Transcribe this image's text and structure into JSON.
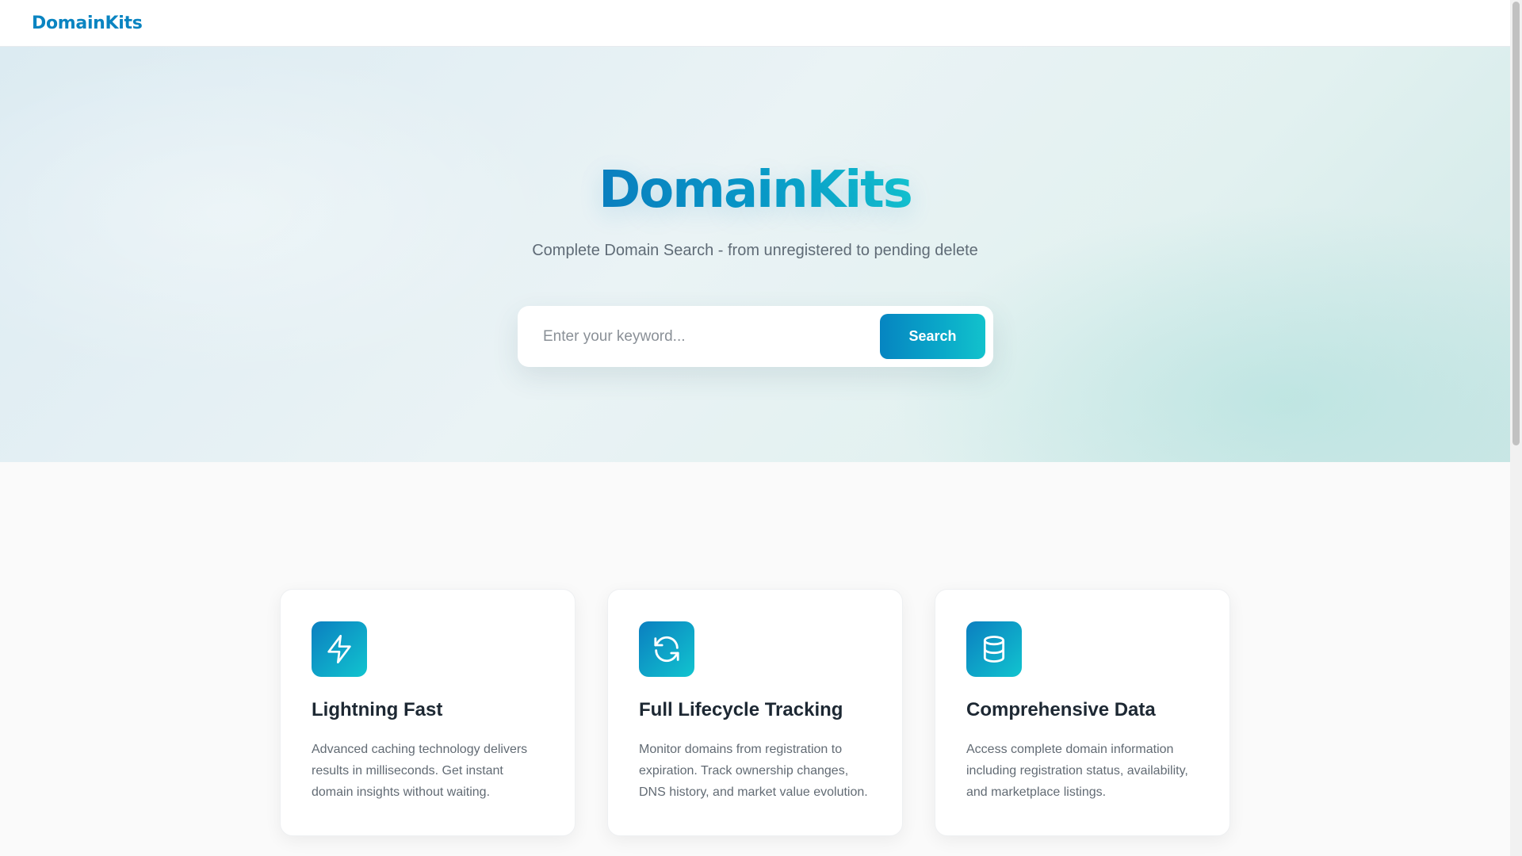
{
  "nav": {
    "brand": "DomainKits"
  },
  "hero": {
    "title": "DomainKits",
    "subtitle": "Complete Domain Search - from unregistered to pending delete",
    "search_placeholder": "Enter your keyword...",
    "search_button": "Search"
  },
  "features": [
    {
      "icon": "lightning-icon",
      "title": "Lightning Fast",
      "description": "Advanced caching technology delivers results in milliseconds. Get instant domain insights without waiting."
    },
    {
      "icon": "refresh-cycle-icon",
      "title": "Full Lifecycle Tracking",
      "description": "Monitor domains from registration to expiration. Track ownership changes, DNS history, and market value evolution."
    },
    {
      "icon": "database-icon",
      "title": "Comprehensive Data",
      "description": "Access complete domain information including registration status, availability, and marketplace listings."
    }
  ],
  "colors": {
    "brand": "#0a84c1",
    "accent": "#12c2cc",
    "text_dark": "#1d2833",
    "text_muted": "#626b74"
  }
}
